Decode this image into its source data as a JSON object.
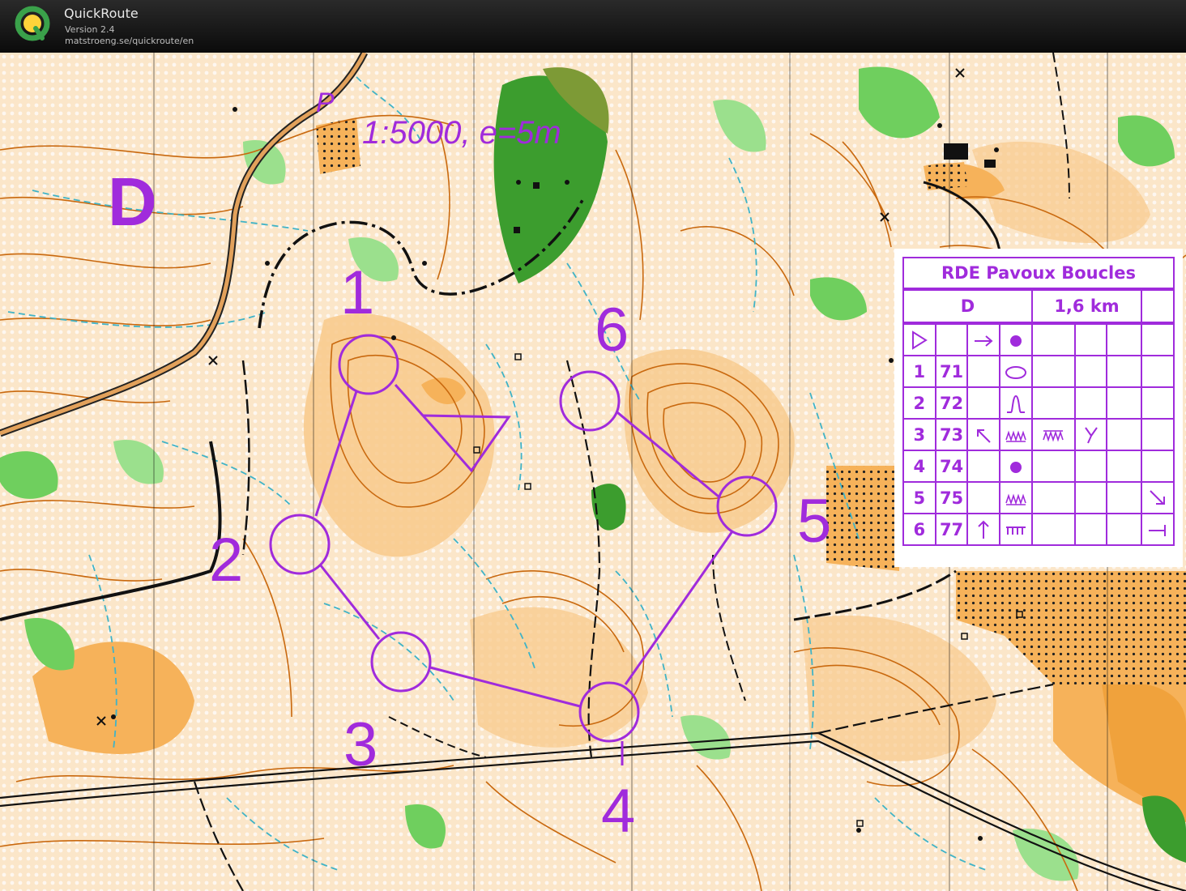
{
  "app": {
    "title": "QuickRoute",
    "version": "Version 2.4",
    "url": "matstroeng.se/quickroute/en"
  },
  "map": {
    "scale_label": "1:5000,  e=5m",
    "parking_label": "P",
    "course_letter": "D",
    "colors": {
      "course": "#a02bdc",
      "contour": "#c9690f",
      "open_land": "#f6b25a",
      "green": "#4cc04a",
      "water": "#3fb3c7"
    },
    "controls": [
      {
        "label": "1"
      },
      {
        "label": "2"
      },
      {
        "label": "3"
      },
      {
        "label": "4"
      },
      {
        "label": "5"
      },
      {
        "label": "6"
      }
    ]
  },
  "description": {
    "title": "RDE Pavoux Boucles",
    "course": "D",
    "length": "1,6 km",
    "start": {
      "symbol": "triangle-icon",
      "direction": "arrow-right-icon",
      "feature": "dot-icon"
    },
    "rows": [
      {
        "num": "1",
        "code": "71",
        "which": "",
        "feature": "ellipse-icon",
        "extra": ""
      },
      {
        "num": "2",
        "code": "72",
        "which": "",
        "feature": "knoll-icon",
        "extra": ""
      },
      {
        "num": "3",
        "code": "73",
        "which": "arrow-up-left-icon",
        "feature": "zigzag-icon",
        "extra": "y-icon"
      },
      {
        "num": "4",
        "code": "74",
        "which": "",
        "feature": "dot-icon",
        "extra": ""
      },
      {
        "num": "5",
        "code": "75",
        "which": "",
        "feature": "zigzag-icon",
        "extra": "corner-icon"
      },
      {
        "num": "6",
        "code": "77",
        "which": "arrow-up-icon",
        "feature": "comb-icon",
        "extra": "t-end-icon"
      }
    ]
  }
}
